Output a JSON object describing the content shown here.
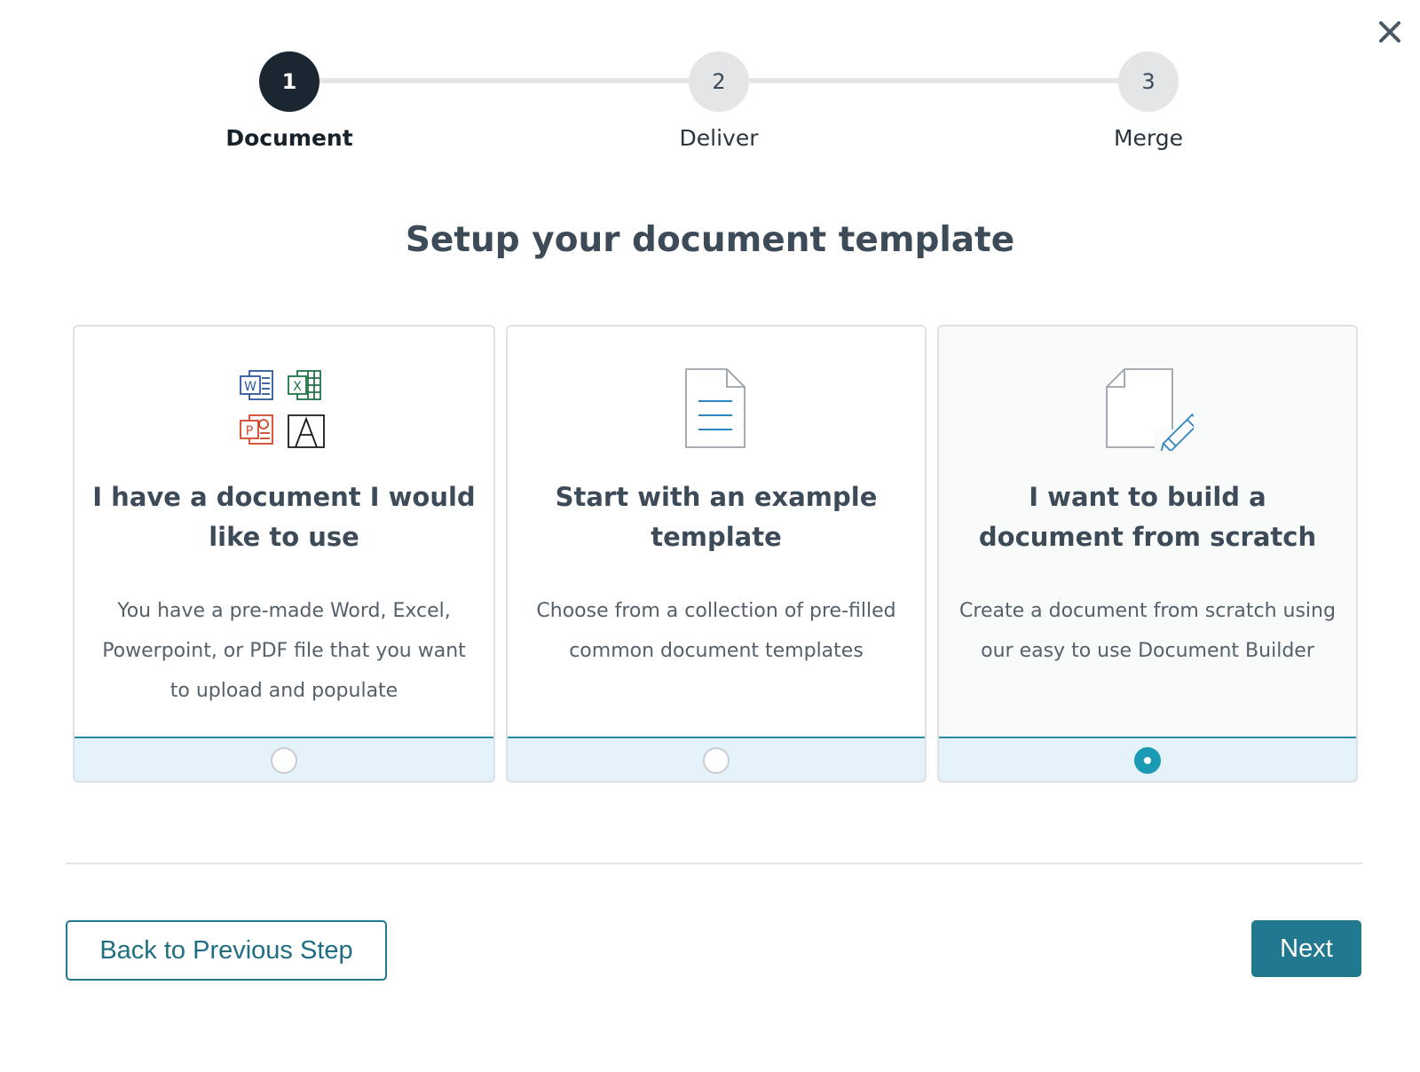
{
  "stepper": {
    "steps": [
      {
        "number": "1",
        "label": "Document",
        "active": true
      },
      {
        "number": "2",
        "label": "Deliver",
        "active": false
      },
      {
        "number": "3",
        "label": "Merge",
        "active": false
      }
    ]
  },
  "page": {
    "title": "Setup your document template"
  },
  "options": [
    {
      "title": "I have a document I would like to use",
      "description": "You have a pre-made Word, Excel, Powerpoint, or PDF file that you want to upload and populate",
      "icon": "office-files-icon",
      "selected": false
    },
    {
      "title": "Start with an example template",
      "description": "Choose from a collection of pre-filled common document templates",
      "icon": "document-template-icon",
      "selected": false
    },
    {
      "title": "I want to build a document from scratch",
      "description": "Create a document from scratch using our easy to use Document Builder",
      "icon": "document-pencil-icon",
      "selected": true
    }
  ],
  "actions": {
    "back_label": "Back to Previous Step",
    "next_label": "Next"
  },
  "icons": {
    "word_letter": "W",
    "excel_letter": "X",
    "powerpoint_letter": "P"
  },
  "colors": {
    "accent": "#22788e",
    "radio_selected": "#1b9bb3",
    "footer_bg": "#e3f3f9",
    "step_active": "#1a2731",
    "word": "#2b579a",
    "excel": "#217346",
    "powerpoint": "#d24726"
  }
}
